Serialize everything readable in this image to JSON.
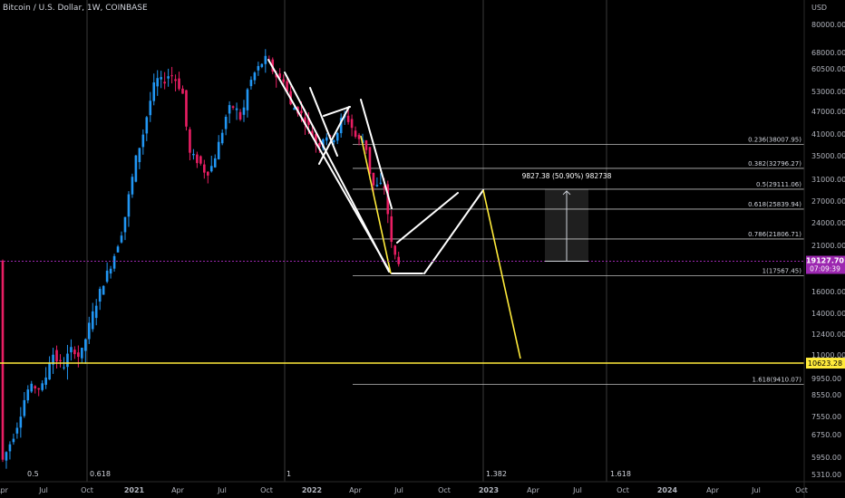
{
  "header": {
    "title": "Bitcoin / U.S. Dollar, 1W, COINBASE"
  },
  "chart_data": {
    "type": "candlestick",
    "scale": "log",
    "currency_label": "USD",
    "y_ticks": [
      80000,
      68000,
      60500,
      53000,
      47000,
      41000,
      35000,
      31000,
      27000,
      24000,
      21000,
      16000,
      14000,
      12400,
      11000,
      9950,
      8550,
      7550,
      6750,
      5950,
      5310
    ],
    "x_ticks": [
      "Apr",
      "Jul",
      "Oct",
      "2021",
      "Apr",
      "Jul",
      "Oct",
      "2022",
      "Apr",
      "Jul",
      "Oct",
      "2023",
      "Apr",
      "Jul",
      "Oct",
      "2024",
      "Apr",
      "Jul",
      "Oct"
    ],
    "bottom_fib_labels": [
      "0.5",
      "0.618",
      "1",
      "1.382",
      "1.618"
    ],
    "current_price": {
      "label": "19127.70",
      "countdown": "07:09:39",
      "color": "#9c27b0"
    },
    "target_level": {
      "label": "10623.28",
      "color": "#ffeb3b"
    },
    "fib_levels": [
      {
        "label": "0.236(38007.95)"
      },
      {
        "label": "0.382(32796.27)"
      },
      {
        "label": "0.5(29111.06)"
      },
      {
        "label": "0.618(25839.94)"
      },
      {
        "label": "0.786(21806.71)"
      },
      {
        "label": "1(17567.45)"
      },
      {
        "label": "1.618(9410.07)"
      }
    ],
    "measure_label": "9827.38 (50.90%) 982738",
    "colors": {
      "up": "#2196f3",
      "down": "#e91e63",
      "projection": "#ffeb3b",
      "pattern": "#ffffff"
    }
  }
}
